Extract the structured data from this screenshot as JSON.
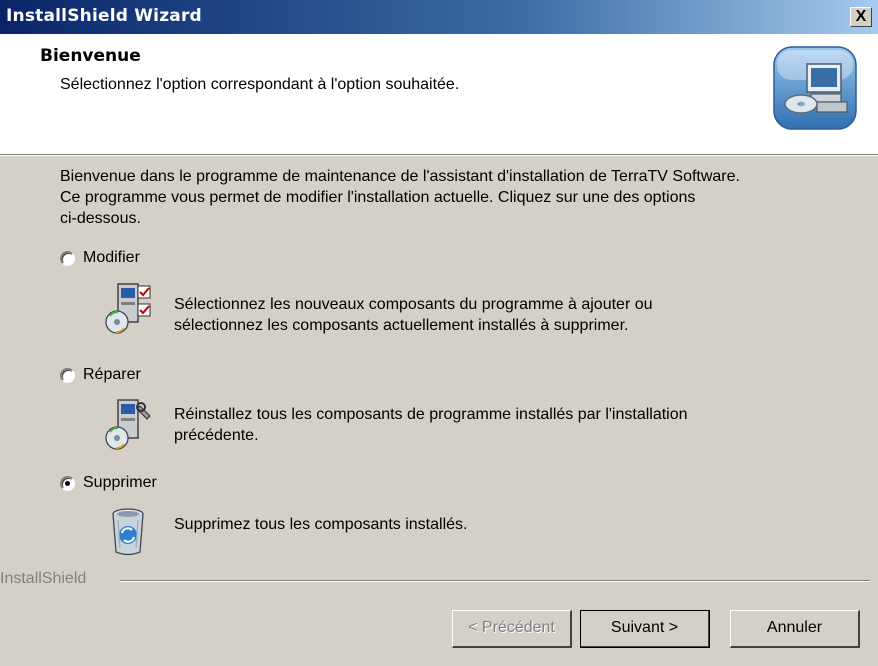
{
  "window": {
    "title": "InstallShield Wizard",
    "close_label": "X"
  },
  "header": {
    "title": "Bienvenue",
    "subtitle": "Sélectionnez l'option correspondant à l'option souhaitée.",
    "icon": "computer-cd-setup-icon"
  },
  "intro": {
    "line1": "Bienvenue dans le programme de maintenance de l'assistant d'installation de TerraTV Software.",
    "line2": "Ce programme vous permet de modifier l'installation actuelle. Cliquez sur une des options",
    "line3": "ci-dessous."
  },
  "options": [
    {
      "label": "Modifier",
      "selected": false,
      "icon": "modify-components-icon",
      "desc_line1": "Sélectionnez les nouveaux composants du programme à ajouter ou",
      "desc_line2": "sélectionnez les composants actuellement installés à supprimer."
    },
    {
      "label": "Réparer",
      "selected": false,
      "icon": "repair-icon",
      "desc_line1": "Réinstallez tous les composants de programme installés par l'installation",
      "desc_line2": "précédente."
    },
    {
      "label": "Supprimer",
      "selected": true,
      "icon": "recycle-bin-icon",
      "desc_line1": "Supprimez tous les composants installés.",
      "desc_line2": ""
    }
  ],
  "footer": {
    "group_label": "InstallShield",
    "back_label": "< Précédent",
    "next_label": "Suivant >",
    "cancel_label": "Annuler"
  },
  "colors": {
    "title_start": "#0a246a",
    "title_end": "#a6caf0",
    "face": "#d4d0c8"
  }
}
